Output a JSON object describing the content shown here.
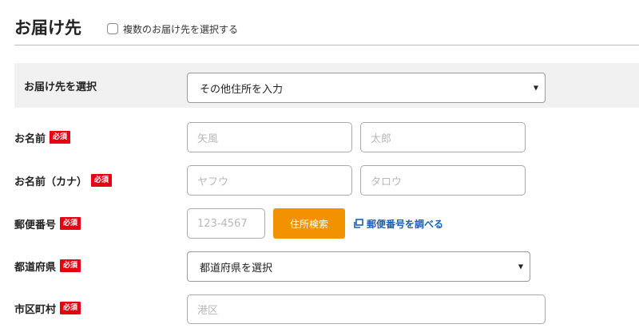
{
  "header": {
    "title": "お届け先",
    "multi_label": "複数のお届け先を選択する"
  },
  "destination": {
    "label": "お届け先を選択",
    "selected": "その他住所を入力"
  },
  "required_badge": "必須",
  "name": {
    "label": "お名前",
    "last_placeholder": "矢風",
    "first_placeholder": "太郎"
  },
  "kana": {
    "label": "お名前（カナ）",
    "last_placeholder": "ヤフウ",
    "first_placeholder": "タロウ"
  },
  "postal": {
    "label": "郵便番号",
    "placeholder": "123-4567",
    "search_button": "住所検索",
    "lookup_link": "郵便番号を調べる"
  },
  "prefecture": {
    "label": "都道府県",
    "selected": "都道府県を選択"
  },
  "city": {
    "label": "市区町村",
    "placeholder": "港区"
  },
  "colors": {
    "accent": "#f39200",
    "required": "#e60012",
    "link": "#1a5fb4"
  }
}
